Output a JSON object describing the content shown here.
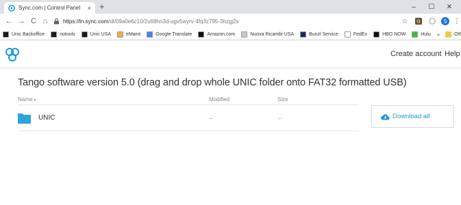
{
  "browser": {
    "tab_title": "Sync.com | Control Panel",
    "tab_close": "×",
    "new_tab": "+",
    "window_controls": {
      "minimize": "–",
      "maximize": "☐",
      "close": "✕"
    },
    "url_host": "https://ln.sync.com",
    "url_path": "/dl/09a0e6c10/2u68hn3d-ugv5wyrv-4fq3z795-3hzgj2s",
    "nav": {
      "back": "←",
      "forward": "→",
      "reload": "C",
      "home": "⌂"
    },
    "toolbar_icons": {
      "star": "☆",
      "profile_letter": "S",
      "menu": "⋮"
    },
    "bookmarks": [
      {
        "label": "Unic Backoffice",
        "icon_color": "#1a1a1a"
      },
      {
        "label": "notools",
        "icon_color": "#1a1a1a"
      },
      {
        "label": "Unic USA",
        "icon_color": "#1a1a1a"
      },
      {
        "label": "eMaint",
        "icon_color": "#f2b134"
      },
      {
        "label": "Google Translate",
        "icon_color": "#4285f4"
      },
      {
        "label": "Amazon.com",
        "icon_color": "#111111"
      },
      {
        "label": "Nuova Ricambi USA",
        "icon_color": "#c9c9c9"
      },
      {
        "label": "Bunzl Service",
        "icon_color": "#1b2a5c"
      },
      {
        "label": "FedEx",
        "icon_color": "#ffffff"
      },
      {
        "label": "HBO NOW",
        "icon_color": "#111111"
      },
      {
        "label": "Hulu",
        "icon_color": "#3dbb3d"
      }
    ],
    "bookmarks_overflow": "»",
    "other_bookmarks": "Other bookmarks"
  },
  "header": {
    "create_account": "Create account",
    "help": "Help"
  },
  "main": {
    "title": "Tango software version 5.0 (drag and drop whole UNIC folder onto FAT32 formatted USB)",
    "columns": {
      "name": "Name",
      "name_caret": "▾",
      "modified": "Modified",
      "size": "Size"
    },
    "rows": [
      {
        "name": "UNIC",
        "modified": "--",
        "size": "--"
      }
    ],
    "download_all": "Download all"
  },
  "colors": {
    "accent": "#1a9ad6",
    "folder": "#2ca4e0"
  }
}
